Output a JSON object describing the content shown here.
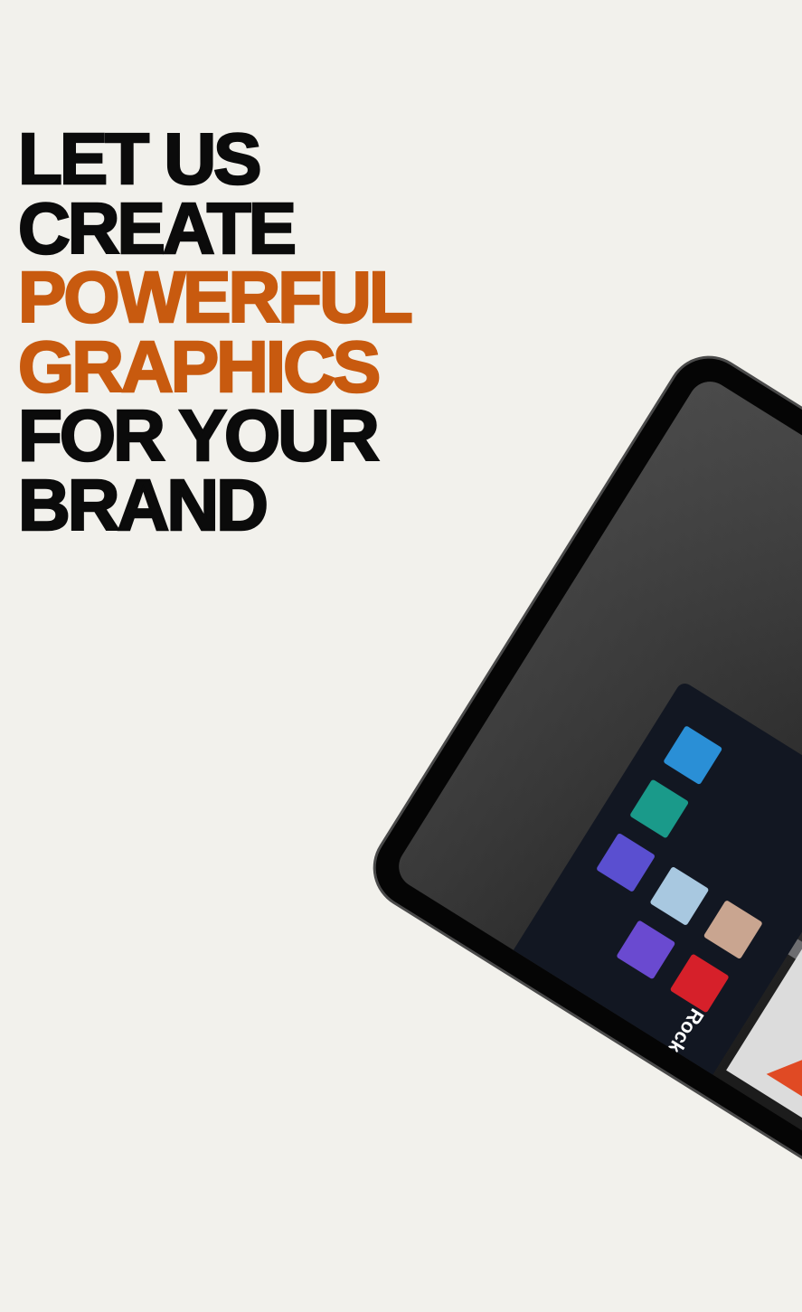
{
  "headline": {
    "lines": [
      {
        "text": "LET US",
        "accent": false
      },
      {
        "text": "CREATE",
        "accent": false
      },
      {
        "text": "POWERFUL",
        "accent": true
      },
      {
        "text": "GRAPHICS",
        "accent": true
      },
      {
        "text": "FOR YOUR",
        "accent": false
      },
      {
        "text": "BRAND",
        "accent": false
      }
    ]
  },
  "colors": {
    "background": "#f2f1ec",
    "text": "#0b0b0b",
    "accent": "#c85a0f"
  },
  "image": {
    "tablet_screen_text": "Rock"
  }
}
